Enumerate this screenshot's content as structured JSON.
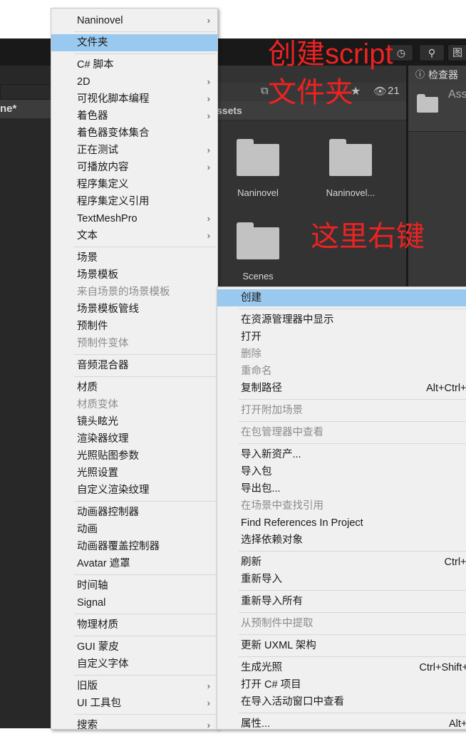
{
  "editor": {
    "left_tab_fragment": "ne*",
    "assets_header": "ssets",
    "visibility_count": "21",
    "inspector_title": "检查器",
    "inspector_fragment": "Ass",
    "layout_fragment": "图",
    "folders": [
      "Naninovel",
      "Naninovel...",
      "Scenes"
    ]
  },
  "annotations": {
    "line1": "创建script",
    "line2": "文件夹",
    "right_click": "这里右键"
  },
  "create_menu": {
    "items": [
      {
        "label": "Naninovel",
        "arrow": true
      },
      {
        "sep": true
      },
      {
        "label": "文件夹",
        "selected": true
      },
      {
        "sep": true
      },
      {
        "label": "C# 脚本"
      },
      {
        "label": "2D",
        "arrow": true
      },
      {
        "label": "可视化脚本编程",
        "arrow": true
      },
      {
        "label": "着色器",
        "arrow": true
      },
      {
        "label": "着色器变体集合"
      },
      {
        "label": "正在测试",
        "arrow": true
      },
      {
        "label": "可播放内容",
        "arrow": true
      },
      {
        "label": "程序集定义"
      },
      {
        "label": "程序集定义引用"
      },
      {
        "label": "TextMeshPro",
        "arrow": true
      },
      {
        "label": "文本",
        "arrow": true
      },
      {
        "sep": true
      },
      {
        "label": "场景"
      },
      {
        "label": "场景模板"
      },
      {
        "label": "来自场景的场景模板",
        "disabled": true
      },
      {
        "label": "场景模板管线"
      },
      {
        "label": "预制件"
      },
      {
        "label": "预制件变体",
        "disabled": true
      },
      {
        "sep": true
      },
      {
        "label": "音频混合器"
      },
      {
        "sep": true
      },
      {
        "label": "材质"
      },
      {
        "label": "材质变体",
        "disabled": true
      },
      {
        "label": "镜头眩光"
      },
      {
        "label": "渲染器纹理"
      },
      {
        "label": "光照贴图参数"
      },
      {
        "label": "光照设置"
      },
      {
        "label": "自定义渲染纹理"
      },
      {
        "sep": true
      },
      {
        "label": "动画器控制器"
      },
      {
        "label": "动画"
      },
      {
        "label": "动画器覆盖控制器"
      },
      {
        "label": "Avatar 遮罩"
      },
      {
        "sep": true
      },
      {
        "label": "时间轴"
      },
      {
        "label": "Signal"
      },
      {
        "sep": true
      },
      {
        "label": "物理材质"
      },
      {
        "sep": true
      },
      {
        "label": "GUI 蒙皮"
      },
      {
        "label": "自定义字体"
      },
      {
        "sep": true
      },
      {
        "label": "旧版",
        "arrow": true
      },
      {
        "label": "UI 工具包",
        "arrow": true
      },
      {
        "sep": true
      },
      {
        "label": "搜索",
        "arrow": true
      }
    ]
  },
  "context_menu": {
    "items": [
      {
        "label": "创建",
        "selected": true
      },
      {
        "sep": true
      },
      {
        "label": "在资源管理器中显示"
      },
      {
        "label": "打开"
      },
      {
        "label": "删除",
        "disabled": true
      },
      {
        "label": "重命名",
        "disabled": true
      },
      {
        "label": "复制路径",
        "shortcut": "Alt+Ctrl+C"
      },
      {
        "sep": true
      },
      {
        "label": "打开附加场景",
        "disabled": true
      },
      {
        "sep": true
      },
      {
        "label": "在包管理器中查看",
        "disabled": true
      },
      {
        "sep": true
      },
      {
        "label": "导入新资产..."
      },
      {
        "label": "导入包"
      },
      {
        "label": "导出包..."
      },
      {
        "label": "在场景中查找引用",
        "disabled": true
      },
      {
        "label": "Find References In Project"
      },
      {
        "label": "选择依赖对象"
      },
      {
        "sep": true
      },
      {
        "label": "刷新",
        "shortcut": "Ctrl+R"
      },
      {
        "label": "重新导入"
      },
      {
        "sep": true
      },
      {
        "label": "重新导入所有"
      },
      {
        "sep": true
      },
      {
        "label": "从预制件中提取",
        "disabled": true
      },
      {
        "sep": true
      },
      {
        "label": "更新 UXML 架构"
      },
      {
        "sep": true
      },
      {
        "label": "生成光照",
        "shortcut": "Ctrl+Shift+L"
      },
      {
        "label": "打开 C# 项目"
      },
      {
        "label": "在导入活动窗口中查看"
      },
      {
        "sep": true
      },
      {
        "label": "属性...",
        "shortcut": "Alt+P"
      }
    ]
  }
}
